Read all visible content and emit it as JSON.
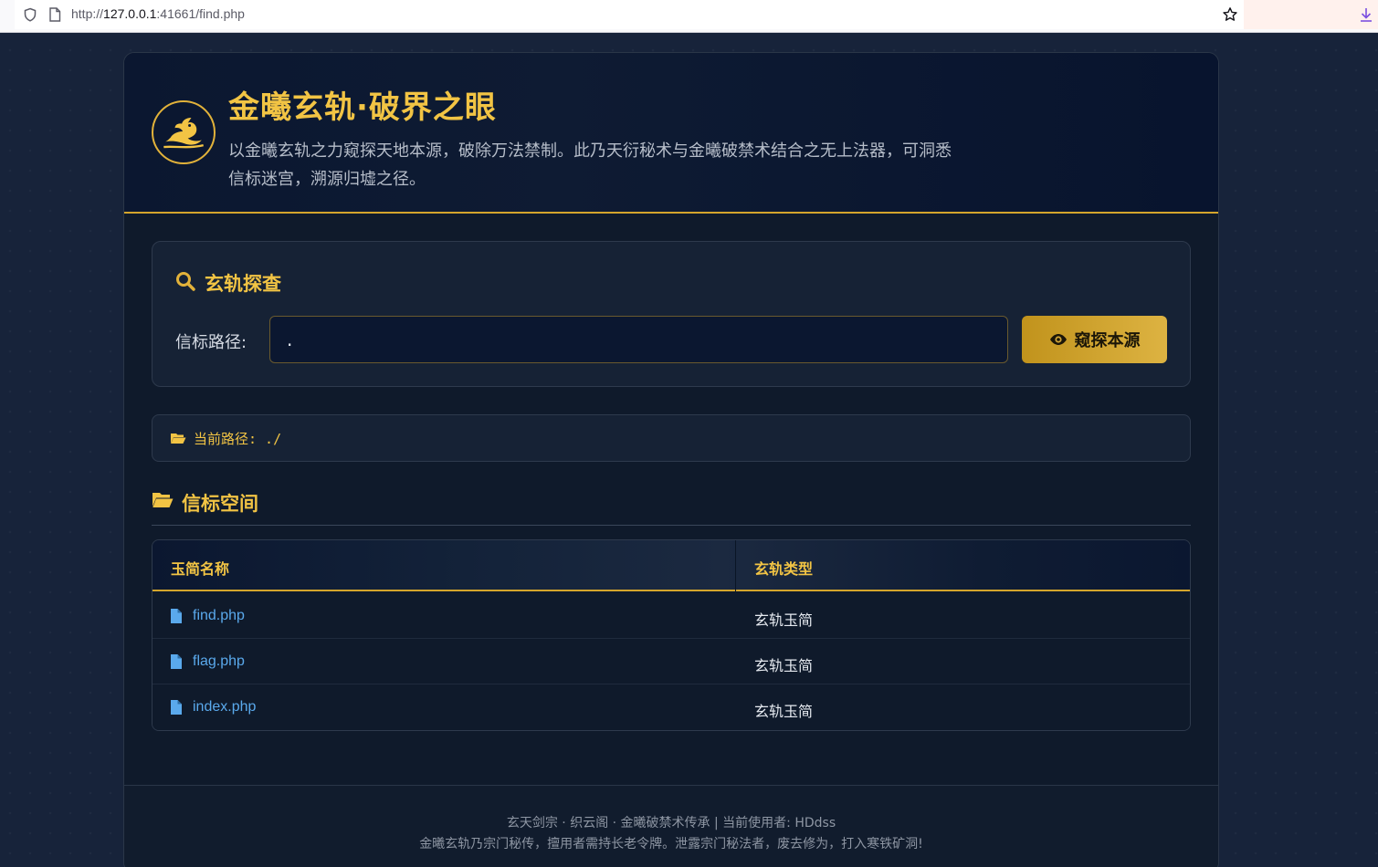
{
  "browser": {
    "url_prefix": "http://",
    "url_host": "127.0.0.1",
    "url_rest": ":41661/find.php"
  },
  "header": {
    "title": "金曦玄轨·破界之眼",
    "subtitle": "以金曦玄轨之力窥探天地本源，破除万法禁制。此乃天衍秘术与金曦破禁术结合之无上法器，可洞悉信标迷宫，溯源归墟之径。"
  },
  "search": {
    "panel_title": "玄轨探查",
    "path_label": "信标路径:",
    "path_value": ".",
    "button_label": "窥探本源"
  },
  "current_path": {
    "text": "当前路径: ./"
  },
  "listing": {
    "section_title": "信标空间",
    "columns": [
      "玉简名称",
      "玄轨类型"
    ],
    "rows": [
      {
        "name": "find.php",
        "type": "玄轨玉简"
      },
      {
        "name": "flag.php",
        "type": "玄轨玉简"
      },
      {
        "name": "index.php",
        "type": "玄轨玉简"
      }
    ]
  },
  "footer": {
    "line1": "玄天剑宗 · 织云阁 · 金曦破禁术传承 | 当前使用者: HDdss",
    "line2": "金曦玄轨乃宗门秘传，擅用者需持长老令牌。泄露宗门秘法者，废去修为，打入寒铁矿洞!"
  },
  "colors": {
    "gold": "#f2c444",
    "link_blue": "#5aa9ec",
    "background": "#17233a"
  },
  "icons": [
    "shield-icon",
    "page-icon",
    "star-icon",
    "download-icon",
    "dragon-logo-icon",
    "search-icon",
    "eye-icon",
    "folder-icon",
    "folder-open-icon",
    "file-icon"
  ]
}
